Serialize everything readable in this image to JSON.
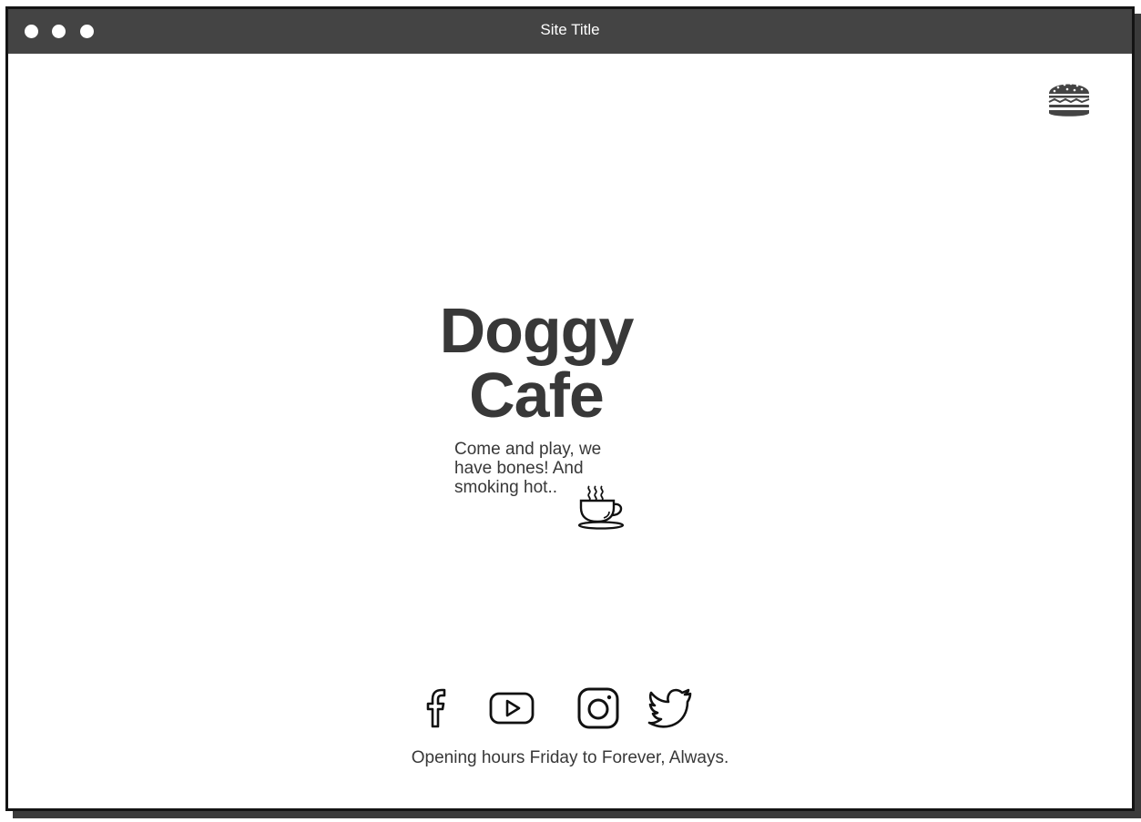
{
  "window": {
    "title": "Site Title"
  },
  "header": {
    "menu_icon": "hamburger-menu-icon"
  },
  "hero": {
    "title_line1": "Doggy",
    "title_line2": "Cafe",
    "tagline": "Come and play, we have bones! And smoking hot..",
    "tagline_icon": "coffee-cup-icon"
  },
  "social": {
    "icons": [
      "facebook-icon",
      "youtube-icon",
      "instagram-icon",
      "twitter-icon"
    ]
  },
  "footer": {
    "text": "Opening hours Friday to Forever, Always."
  },
  "colors": {
    "title_bar": "#444444",
    "text": "#383838",
    "background": "#ffffff"
  }
}
